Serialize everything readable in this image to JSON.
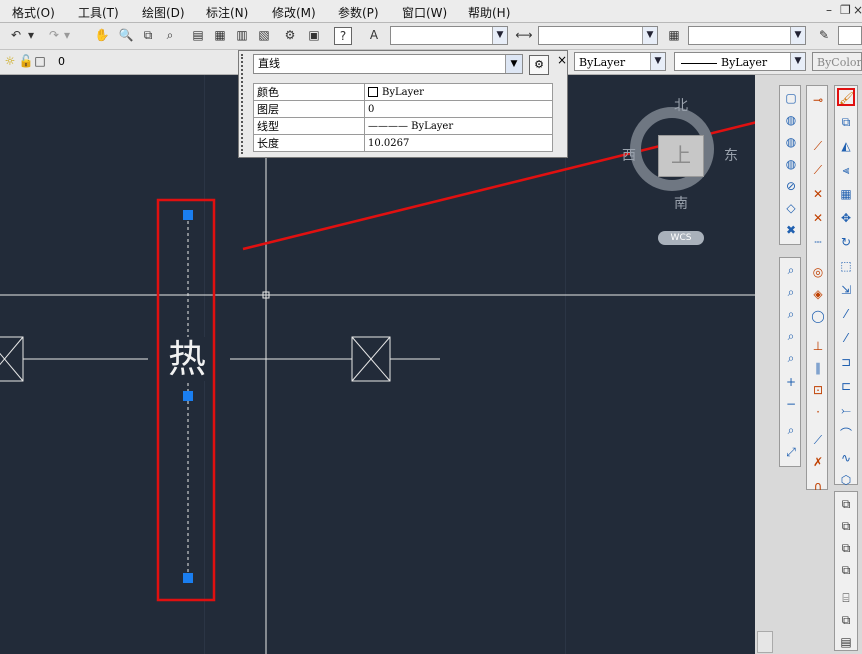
{
  "menu": [
    {
      "label": "格式(O)"
    },
    {
      "label": "工具(T)"
    },
    {
      "label": "绘图(D)"
    },
    {
      "label": "标注(N)"
    },
    {
      "label": "修改(M)"
    },
    {
      "label": "参数(P)"
    },
    {
      "label": "窗口(W)"
    },
    {
      "label": "帮助(H)"
    }
  ],
  "toolbar": {
    "style_combo_1": "",
    "style_combo_2": "",
    "style_combo_3": "",
    "help_label": "?"
  },
  "layer_bar": {
    "current_layer": "0",
    "color": "ByLayer",
    "linetype": "ByLayer",
    "plotstyle": "ByColor"
  },
  "properties": {
    "object_type": "直线",
    "rows": [
      {
        "key": "颜色",
        "value": "ByLayer",
        "swatch": true
      },
      {
        "key": "图层",
        "value": "0"
      },
      {
        "key": "线型",
        "value": "———— ByLayer"
      },
      {
        "key": "长度",
        "value": "10.0267"
      }
    ]
  },
  "viewcube": {
    "north": "北",
    "south": "南",
    "east": "东",
    "west": "西",
    "top": "上",
    "wcs": "WCS"
  },
  "drawing": {
    "text_label": "热",
    "highlight_color": "#e01010",
    "grip_color": "#1a7ef0",
    "canvas_bg": "#222b39"
  }
}
